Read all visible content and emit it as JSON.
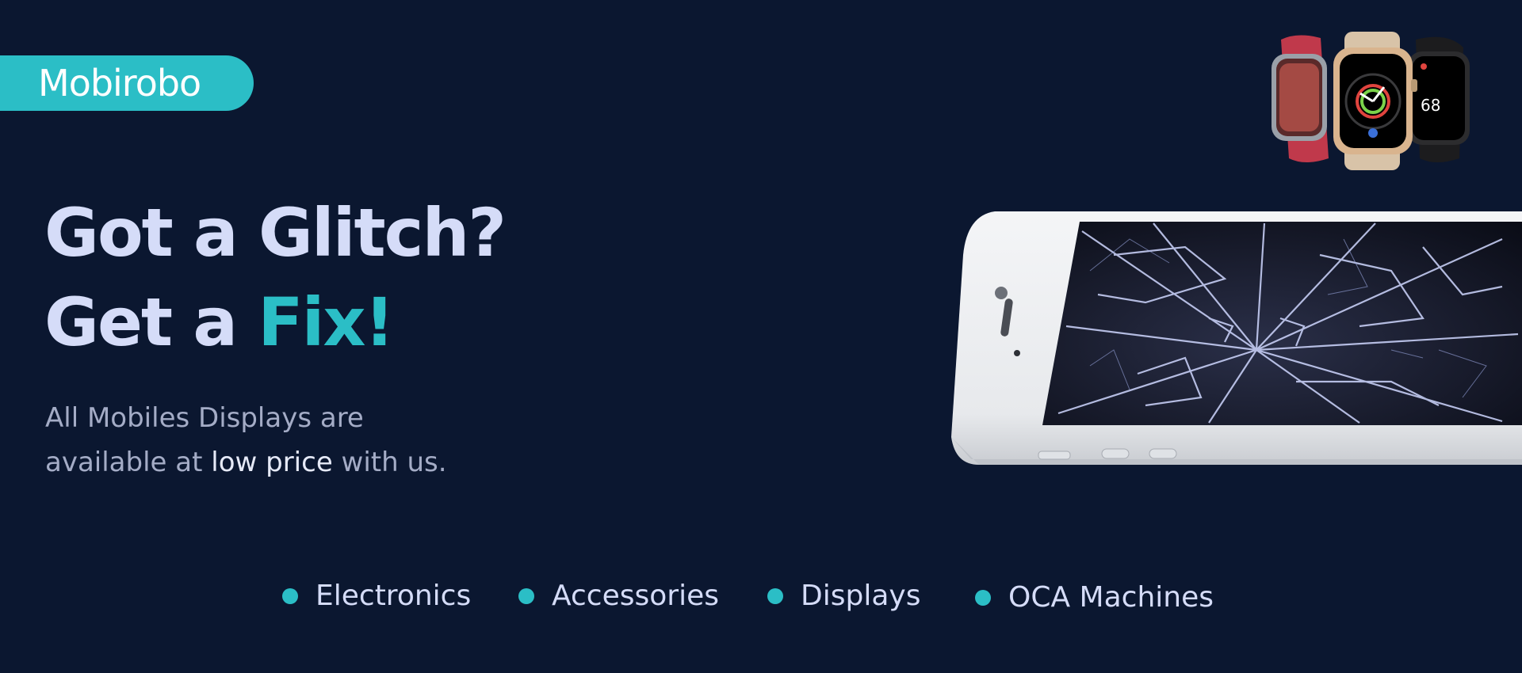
{
  "brand": {
    "logo_text": "Mobirobo"
  },
  "hero": {
    "line1": "Got a Glitch?",
    "line2_prefix": "Get a ",
    "line2_accent": "Fix!",
    "subtext_line1": "All Mobiles Displays are",
    "subtext_line2_prefix": "available at ",
    "subtext_highlight": "low price",
    "subtext_line2_suffix": " with us."
  },
  "categories": [
    {
      "label": "Electronics"
    },
    {
      "label": "Accessories"
    },
    {
      "label": "Displays"
    },
    {
      "label": "OCA Machines"
    }
  ],
  "colors": {
    "background": "#0b1730",
    "accent": "#2bbec6",
    "headline": "#d5dcf8",
    "subtext": "#a4acc6"
  },
  "images": {
    "watch": "apple-watch-product-photo",
    "phone": "cracked-screen-smartphone-photo"
  }
}
